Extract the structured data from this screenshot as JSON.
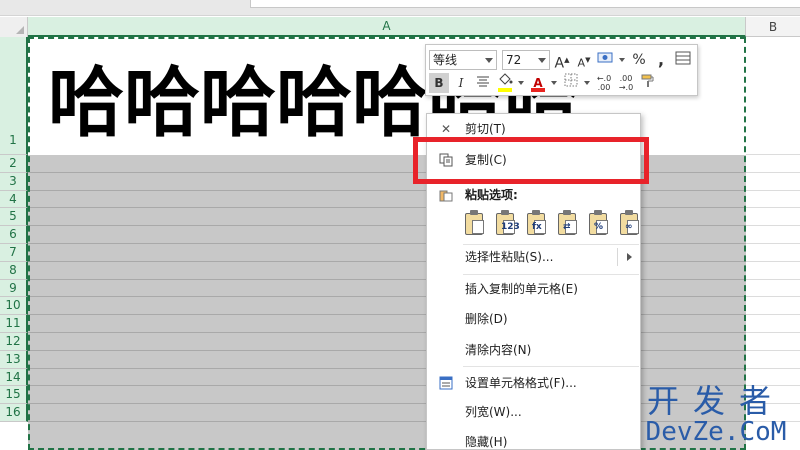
{
  "sheet": {
    "columns": [
      "A",
      "B"
    ],
    "rows": [
      "1",
      "2",
      "3",
      "4",
      "5",
      "6",
      "7",
      "8",
      "9",
      "10",
      "11",
      "12",
      "13",
      "14",
      "15",
      "16"
    ],
    "cell_a1_text": "哈哈哈哈哈哈哈"
  },
  "mini_toolbar": {
    "font_name": "等线",
    "font_size": "72",
    "grow_font": "A",
    "shrink_font": "A",
    "percent": "%",
    "comma": ",",
    "bold": "B",
    "italic": "I",
    "font_color": "A",
    "highlight_color": "#ffff00",
    "font_color_value": "#e8231f"
  },
  "context_menu": {
    "items": [
      {
        "label": "剪切(T)",
        "icon": "scissors-icon"
      },
      {
        "label": "复制(C)",
        "icon": "copy-icon"
      },
      {
        "label": "粘贴选项:",
        "icon": "paste-icon"
      },
      {
        "label": "选择性粘贴(S)...",
        "icon": ""
      },
      {
        "label": "插入复制的单元格(E)",
        "icon": ""
      },
      {
        "label": "删除(D)",
        "icon": ""
      },
      {
        "label": "清除内容(N)",
        "icon": ""
      },
      {
        "label": "设置单元格格式(F)...",
        "icon": "format-cells-icon"
      },
      {
        "label": "列宽(W)...",
        "icon": ""
      },
      {
        "label": "隐藏(H)",
        "icon": ""
      }
    ],
    "paste_options": [
      {
        "name": "paste",
        "tag": ""
      },
      {
        "name": "paste-values",
        "tag": "123"
      },
      {
        "name": "paste-formulas",
        "tag": "fx"
      },
      {
        "name": "paste-transpose",
        "tag": "⇄"
      },
      {
        "name": "paste-formatting",
        "tag": "%"
      },
      {
        "name": "paste-link",
        "tag": "∞"
      }
    ]
  },
  "highlight": {
    "color": "#e8232a"
  },
  "watermark": {
    "line1": "开发者",
    "line2": "DevZe.CoM"
  }
}
